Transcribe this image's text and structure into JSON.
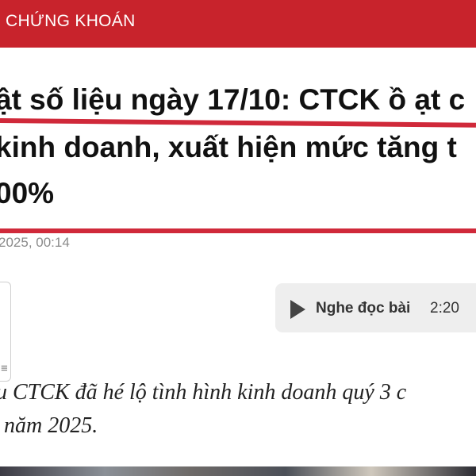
{
  "header": {
    "category": "CHỨNG KHOÁN"
  },
  "article": {
    "headline_lines": [
      "ật số liệu ngày 17/10: CTCK ồ ạt c",
      "kinh doanh, xuất hiện mức tăng t",
      "00%"
    ],
    "date_time": "2025, 00:14",
    "side_icon": "bookmark-icon",
    "lead_lines": [
      "u CTCK đã hé lộ tình hình kinh doanh quý 3 c",
      "năm 2025."
    ]
  },
  "listen": {
    "label": "Nghe đọc bài",
    "duration": "2:20",
    "icon": "play-icon"
  },
  "colors": {
    "brand_red": "#c8232c",
    "highlight_red": "#d0293a",
    "listen_bg": "#eeeeee"
  }
}
